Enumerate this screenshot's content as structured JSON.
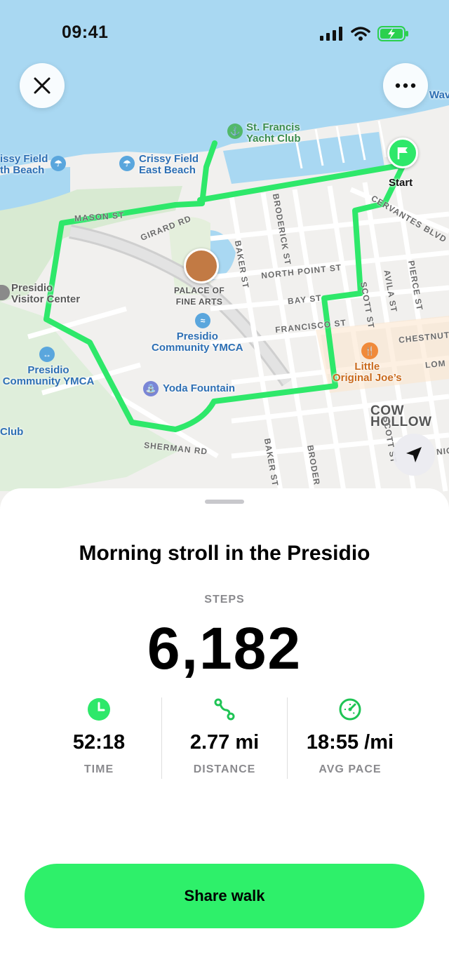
{
  "status_bar": {
    "time": "09:41"
  },
  "map": {
    "pois": {
      "st_francis": "St. Francis\nYacht Club",
      "crissy_beach_left": "issy Field\nth Beach",
      "crissy_east": "Crissy Field\nEast Beach",
      "palace": "PALACE OF\nFINE ARTS",
      "presidio_ymca": "Presidio\nCommunity YMCA",
      "presidio_ymca_left": "Presidio\nCommunity YMCA",
      "visitor_center": "Presidio\nVisitor Center",
      "yoda": "Yoda Fountain",
      "little_joes": "Little\nOriginal Joe’s",
      "club": "Club",
      "cow_hollow": "COW HOLLOW",
      "start": "Start",
      "wav": "Wav"
    },
    "streets": {
      "mason": "MASON ST",
      "girard": "GIRARD RD",
      "baker": "BAKER ST",
      "baker2": "BAKER ST",
      "broderick": "BRODERICK ST",
      "broderick2": "BRODER",
      "north_point": "NORTH POINT ST",
      "bay": "BAY ST",
      "francisco": "FRANCISCO ST",
      "scott": "SCOTT ST",
      "scott2": "SCOTT ST",
      "avila": "AVILA ST",
      "pierce": "PIERCE ST",
      "cervantes": "CERVANTES BLVD",
      "chestnut": "CHESTNUT",
      "lom": "LOM",
      "sherman": "SHERMAN RD",
      "nio": "NIO"
    }
  },
  "walk": {
    "title": "Morning stroll in the Presidio",
    "steps_label": "STEPS",
    "steps_value": "6,182",
    "stats": [
      {
        "icon": "clock-icon",
        "value": "52:18",
        "label": "TIME"
      },
      {
        "icon": "route-icon",
        "value": "2.77 mi",
        "label": "DISTANCE"
      },
      {
        "icon": "speedometer-icon",
        "value": "18:55 /mi",
        "label": "AVG PACE"
      }
    ],
    "share_label": "Share walk"
  },
  "colors": {
    "accent": "#2ef06a",
    "route": "#2ee86a",
    "water": "#a9d8f2"
  }
}
